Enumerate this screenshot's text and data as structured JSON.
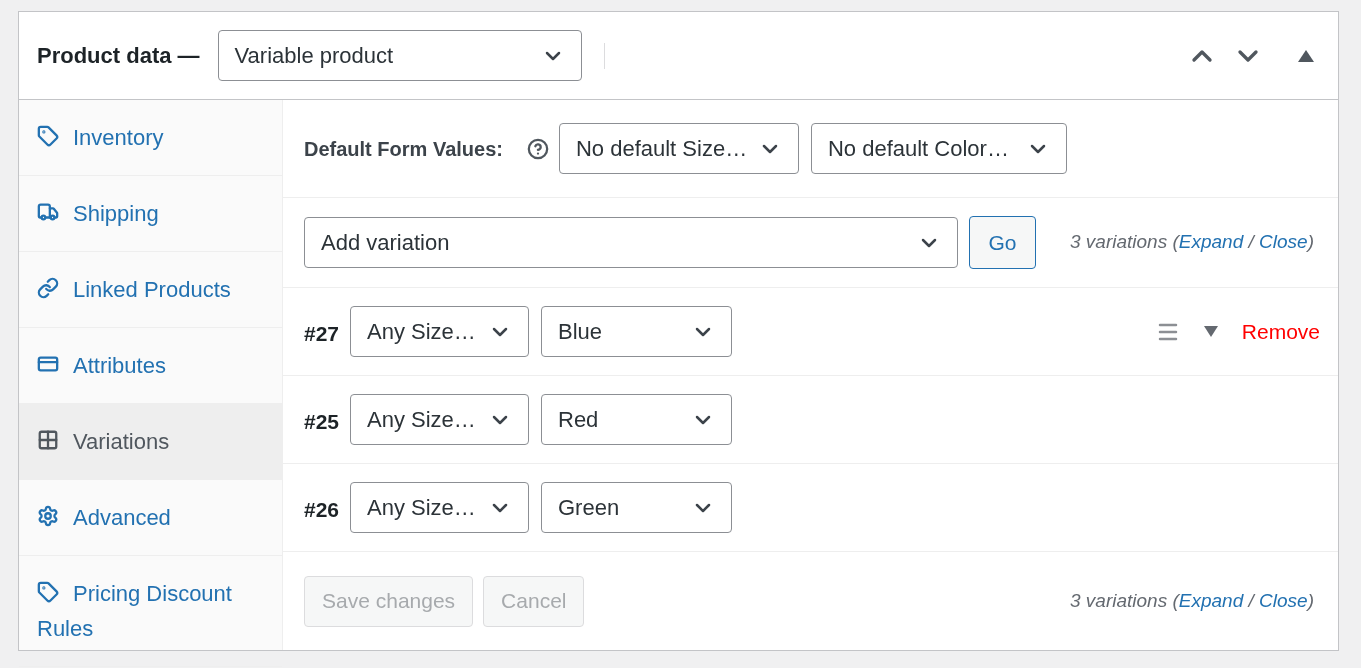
{
  "header": {
    "title": "Product data —",
    "product_type": "Variable product"
  },
  "sidebar": {
    "items": [
      {
        "label": "Inventory",
        "selected": false
      },
      {
        "label": "Shipping",
        "selected": false
      },
      {
        "label": "Linked Products",
        "selected": false
      },
      {
        "label": "Attributes",
        "selected": false
      },
      {
        "label": "Variations",
        "selected": true
      },
      {
        "label": "Advanced",
        "selected": false
      },
      {
        "label": "Pricing Discount Rules",
        "selected": false
      }
    ]
  },
  "defaults": {
    "label": "Default Form Values:",
    "selects": [
      "No default Size…",
      "No default Color…"
    ]
  },
  "add_bar": {
    "action": "Add variation",
    "go": "Go",
    "summary": {
      "prefix": "3 variations (",
      "expand": "Expand",
      "separator": " / ",
      "close": "Close",
      "suffix": ")"
    }
  },
  "variations": [
    {
      "id": "#27",
      "size": "Any Size…",
      "option": "Blue",
      "remove": "Remove"
    },
    {
      "id": "#25",
      "size": "Any Size…",
      "option": "Red"
    },
    {
      "id": "#26",
      "size": "Any Size…",
      "option": "Green"
    }
  ],
  "footer": {
    "save": "Save changes",
    "cancel": "Cancel",
    "save_disabled": true,
    "cancel_disabled": true,
    "summary": {
      "prefix": "3 variations (",
      "expand": "Expand",
      "separator": " / ",
      "close": "Close",
      "suffix": ")"
    }
  }
}
